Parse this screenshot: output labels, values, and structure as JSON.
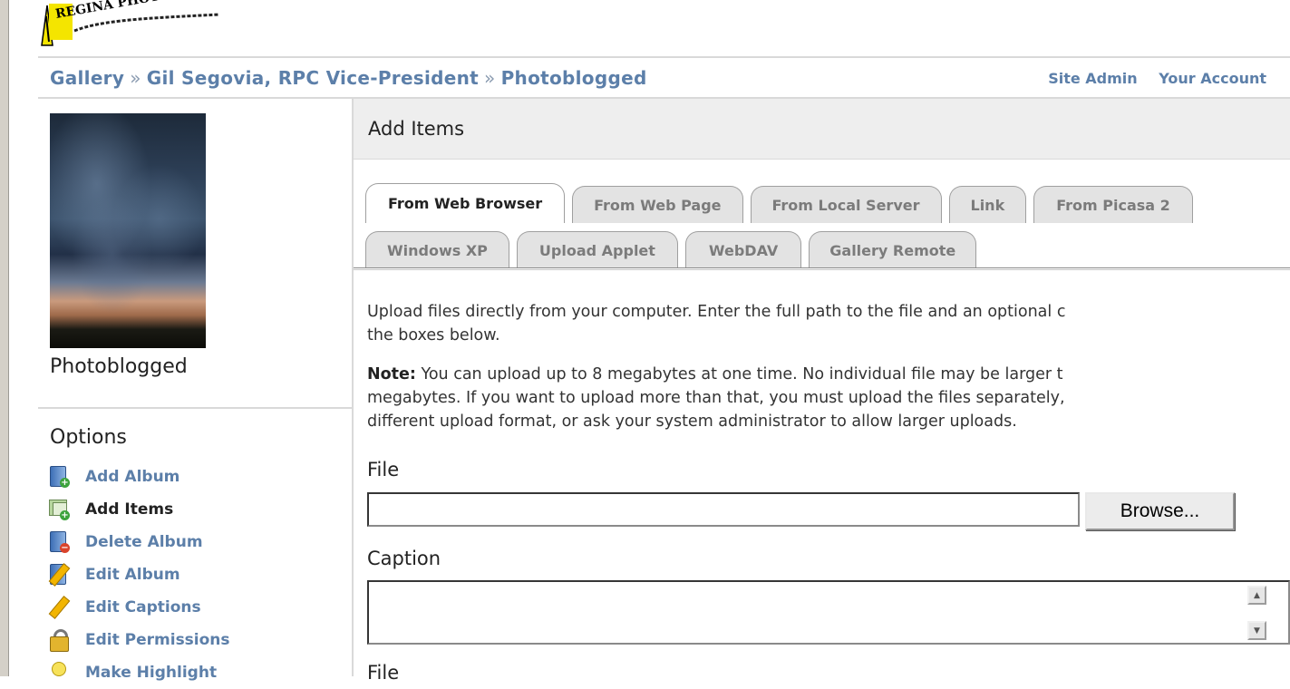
{
  "header": {
    "logo_text": "REGINA PHOTO",
    "breadcrumb": [
      "Gallery",
      "Gil Segovia, RPC Vice-President",
      "Photoblogged"
    ],
    "breadcrumb_separator": "»",
    "site_admin": "Site Admin",
    "your_account": "Your Account"
  },
  "sidebar": {
    "thumbnail_caption": "Photoblogged",
    "options_title": "Options",
    "items": [
      {
        "label": "Add Album",
        "icon": "add-album-icon"
      },
      {
        "label": "Add Items",
        "icon": "add-items-icon",
        "current": true
      },
      {
        "label": "Delete Album",
        "icon": "delete-album-icon"
      },
      {
        "label": "Edit Album",
        "icon": "edit-album-icon"
      },
      {
        "label": "Edit Captions",
        "icon": "edit-captions-icon"
      },
      {
        "label": "Edit Permissions",
        "icon": "edit-permissions-icon"
      },
      {
        "label": "Make Highlight",
        "icon": "make-highlight-icon"
      }
    ]
  },
  "main": {
    "title": "Add Items",
    "tabs_row1": [
      "From Web Browser",
      "From Web Page",
      "From Local Server",
      "Link",
      "From Picasa 2"
    ],
    "tabs_row2": [
      "Windows XP",
      "Upload Applet",
      "WebDAV",
      "Gallery Remote"
    ],
    "active_tab": "From Web Browser",
    "intro_line1": "Upload files directly from your computer. Enter the full path to the file and an optional c",
    "intro_line2": "the boxes below.",
    "note_label": "Note:",
    "note_line1": " You can upload up to 8 megabytes at one time. No individual file may be larger t",
    "note_line2": "megabytes. If you want to upload more than that, you must upload the files separately,",
    "note_line3": "different upload format, or ask your system administrator to allow larger uploads.",
    "file_label": "File",
    "file_value": "",
    "browse_label": "Browse...",
    "caption_label": "Caption",
    "caption_value": "",
    "file_label_2": "File"
  }
}
